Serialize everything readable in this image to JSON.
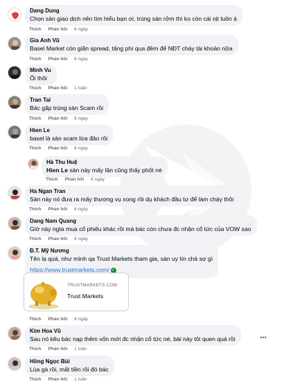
{
  "actions": {
    "like": "Thích",
    "reply": "Phản hồi"
  },
  "comments": [
    {
      "name": "Dang Dung",
      "text": "Chọn sàn giao dịch nên tìm hiểu bạn ơi, trúng sàn rởm thì ko còn cái nịt luôn á",
      "time": "6 ngày"
    },
    {
      "name": "Gia Anh Vũ",
      "text": "Basel Market còn giãn spread, tăng phí qua đêm để NĐT cháy tài khoản nữa",
      "time": "6 ngày"
    },
    {
      "name": "Minh Vu",
      "text": "Ôi thôi",
      "time": "1 tuần"
    },
    {
      "name": "Tran Tai",
      "text": "Bác gặp trúng sàn Scam rồi",
      "time": "6 ngày"
    },
    {
      "name": "Hien Le",
      "text": "basel là sàn scam lừa đảo rồi",
      "time": "6 ngày"
    },
    {
      "name": "Hà Thu Huệ",
      "mention": "Hien Le",
      "text": "sàn này mấy lần cũng thấy phốt nè",
      "time": "6 ngày"
    },
    {
      "name": "Ha Ngan Tran",
      "text": "Sàn này nó đưa ra mấy thương vụ xong rồi dụ khách đầu tư để làm cháy thôi",
      "time": "6 ngày"
    },
    {
      "name": "Dang Nam Quang",
      "text": "Giờ này ngta mua cổ phiếu khác rồi mà bác còn chưa đc nhận cổ tức của VOW sao",
      "time": "6 ngày"
    },
    {
      "name": "Đ.T. Mỹ Nương",
      "text": "Tên lạ quá, như mình qa Trust Markets tham gia, sàn uy tín chả sợ gì",
      "link": "https://www.trustmarkets.com/",
      "time": "6 ngày"
    },
    {
      "name": "Kim Hoa Vũ",
      "text": "Sau nó kêu bác nạp thêm vốn mới đc nhận cổ tức nè, bài này tôi quen quá rồi",
      "time": "1 tuần"
    },
    {
      "name": "Hồng Ngọc Bùi",
      "text": "Lùa gà rồi, mất tiền rồi đó bác",
      "time": "1 tuần"
    }
  ],
  "link_card": {
    "domain": "TRUSTMARKETS.COM",
    "title": "Trust Markets"
  },
  "more_icon": "ellipsis-icon",
  "verified_icon": "check-circle-icon",
  "colors": {
    "bubble": "#f0f2f5",
    "link": "#216fdb",
    "meta": "#65676b"
  }
}
